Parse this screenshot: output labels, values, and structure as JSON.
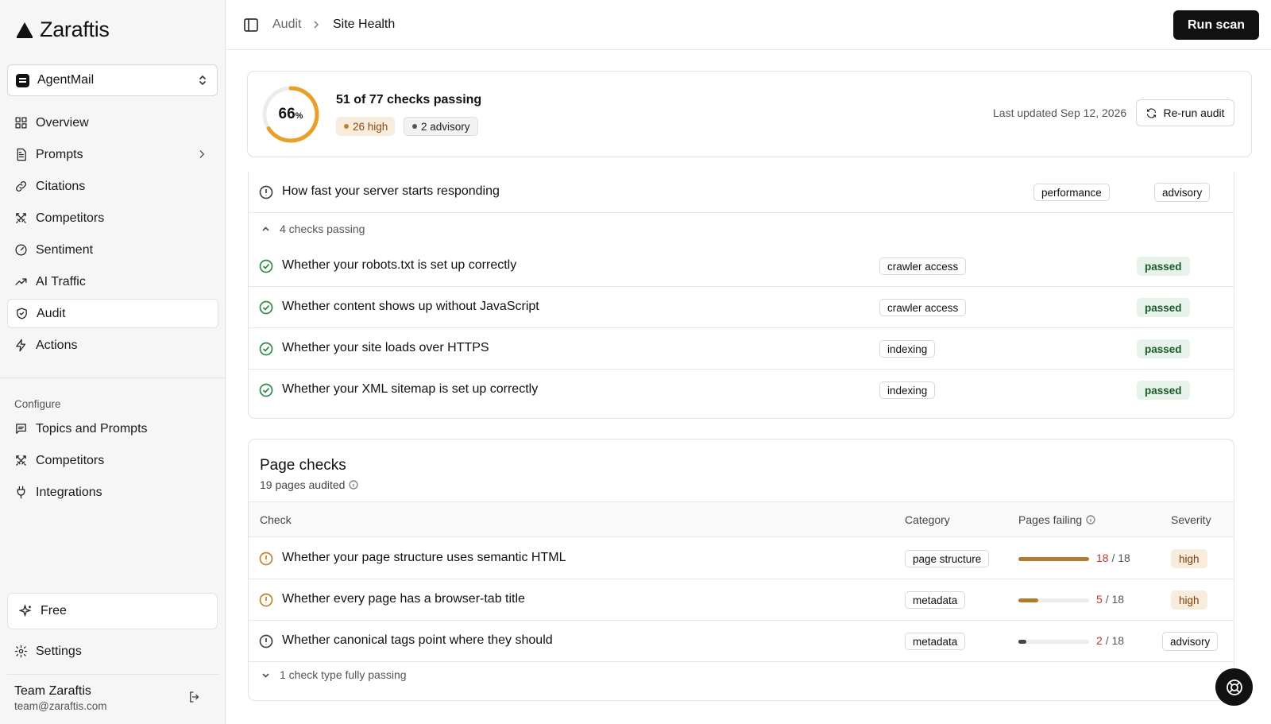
{
  "app": {
    "name": "Zaraftis"
  },
  "workspace": {
    "name": "AgentMail"
  },
  "sidebar": {
    "items": [
      {
        "label": "Overview",
        "icon": "grid-icon"
      },
      {
        "label": "Prompts",
        "icon": "document-icon"
      },
      {
        "label": "Citations",
        "icon": "link-icon"
      },
      {
        "label": "Competitors",
        "icon": "swords-icon"
      },
      {
        "label": "Sentiment",
        "icon": "gauge-icon"
      },
      {
        "label": "AI Traffic",
        "icon": "trending-up-icon"
      },
      {
        "label": "Audit",
        "icon": "shield-icon",
        "active": true
      },
      {
        "label": "Actions",
        "icon": "bolt-icon"
      }
    ],
    "configure_label": "Configure",
    "configure_items": [
      {
        "label": "Topics and Prompts",
        "icon": "message-icon"
      },
      {
        "label": "Competitors",
        "icon": "swords-icon"
      },
      {
        "label": "Integrations",
        "icon": "plug-icon"
      }
    ],
    "plan_label": "Free",
    "settings_label": "Settings",
    "user": {
      "name": "Team Zaraftis",
      "email": "team@zaraftis.com"
    }
  },
  "header": {
    "breadcrumb": [
      "Audit",
      "Site Health"
    ],
    "run_scan_label": "Run scan"
  },
  "summary": {
    "score_value": "66",
    "score_unit": "%",
    "score_fraction": 0.66,
    "title": "51 of 77 checks passing",
    "high_badge": "26 high",
    "advisory_badge": "2 advisory",
    "last_updated": "Last updated Sep 12, 2026",
    "rerun_label": "Re-run audit",
    "ring_color": "#e8a02a"
  },
  "site_checks": {
    "advisory_row": {
      "check": "How fast your server starts responding",
      "category": "performance",
      "severity": "advisory"
    },
    "passing_toggle": "4 checks passing",
    "passing": [
      {
        "check": "Whether your robots.txt is set up correctly",
        "category": "crawler access",
        "status": "passed"
      },
      {
        "check": "Whether content shows up without JavaScript",
        "category": "crawler access",
        "status": "passed"
      },
      {
        "check": "Whether your site loads over HTTPS",
        "category": "indexing",
        "status": "passed"
      },
      {
        "check": "Whether your XML sitemap is set up correctly",
        "category": "indexing",
        "status": "passed"
      }
    ]
  },
  "page_checks": {
    "title": "Page checks",
    "subtitle": "19 pages audited",
    "columns": [
      "Check",
      "Category",
      "Pages failing",
      "Severity"
    ],
    "rows": [
      {
        "check": "Whether your page structure uses semantic HTML",
        "category": "page structure",
        "failing": "18",
        "total": "/ 18",
        "fraction": 1.0,
        "severity": "high"
      },
      {
        "check": "Whether every page has a browser-tab title",
        "category": "metadata",
        "failing": "5",
        "total": "/ 18",
        "fraction": 0.2778,
        "severity": "high"
      },
      {
        "check": "Whether canonical tags point where they should",
        "category": "metadata",
        "failing": "2",
        "total": "/ 18",
        "fraction": 0.1111,
        "severity": "advisory"
      }
    ],
    "footer_toggle": "1 check type fully passing"
  }
}
